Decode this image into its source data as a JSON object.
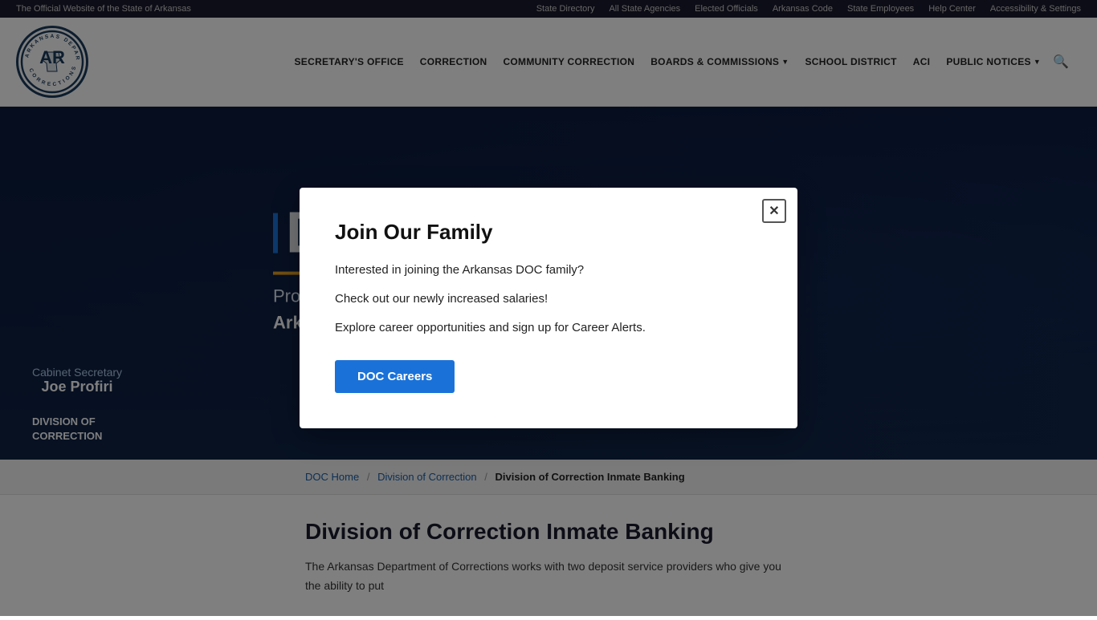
{
  "topbar": {
    "official_text": "The Official Website of the State of Arkansas",
    "links": [
      {
        "label": "State Directory",
        "name": "state-directory-link"
      },
      {
        "label": "All State Agencies",
        "name": "all-agencies-link"
      },
      {
        "label": "Elected Officials",
        "name": "elected-officials-link"
      },
      {
        "label": "Arkansas Code",
        "name": "arkansas-code-link"
      },
      {
        "label": "State Employees",
        "name": "state-employees-link"
      },
      {
        "label": "Help Center",
        "name": "help-center-link"
      },
      {
        "label": "Accessibility & Settings",
        "name": "accessibility-link"
      }
    ]
  },
  "nav": {
    "links": [
      {
        "label": "SECRETARY'S OFFICE",
        "name": "secretarys-office-nav",
        "dropdown": false
      },
      {
        "label": "CORRECTION",
        "name": "correction-nav",
        "dropdown": false
      },
      {
        "label": "COMMUNITY CORRECTION",
        "name": "community-correction-nav",
        "dropdown": false
      },
      {
        "label": "BOARDS & COMMISSIONS",
        "name": "boards-commissions-nav",
        "dropdown": true
      },
      {
        "label": "SCHOOL DISTRICT",
        "name": "school-district-nav",
        "dropdown": false
      },
      {
        "label": "ACI",
        "name": "aci-nav",
        "dropdown": false
      },
      {
        "label": "PUBLIC NOTICES",
        "name": "public-notices-nav",
        "dropdown": true
      }
    ]
  },
  "sidebar": {
    "cabinet_title": "Cabinet Secretary",
    "name": "Joe Profiri",
    "division_line1": "DIVISION OF",
    "division_line2": "CORRECTION"
  },
  "hero": {
    "doc_letter": "D",
    "tagline_line1": "Providing correctional services for",
    "tagline_line2": "Arkansas."
  },
  "breadcrumb": {
    "home_link": "DOC Home",
    "sep1": "/",
    "division_link": "Division of Correction",
    "sep2": "/",
    "current": "Division of Correction Inmate Banking"
  },
  "main": {
    "page_title": "Division of Correction Inmate Banking",
    "intro_text": "The Arkansas Department of Corrections works with two deposit service providers who give you the ability to put"
  },
  "modal": {
    "title": "Join Our Family",
    "text1": "Interested in joining the Arkansas DOC family?",
    "text2": "Check out our newly increased salaries!",
    "text3": "Explore career opportunities and sign up for Career Alerts.",
    "cta_label": "DOC Careers",
    "close_label": "✕"
  }
}
